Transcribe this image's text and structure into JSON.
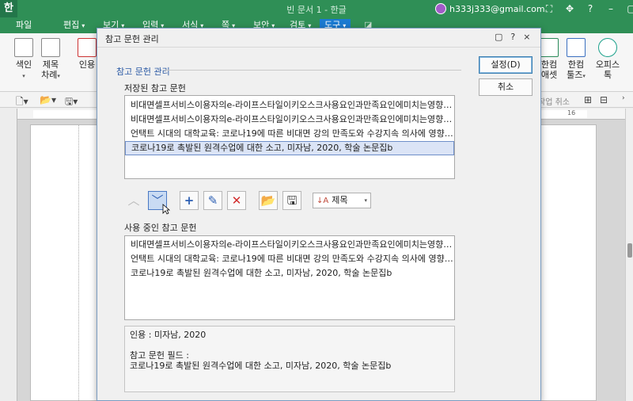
{
  "app": {
    "logo_char": "한",
    "window_title": "빈 문서 1 - 한글",
    "account_email": "h333j333@gmail.com"
  },
  "menu": [
    {
      "label": "파일",
      "caret": ""
    },
    {
      "label": "편집",
      "caret": "▾"
    },
    {
      "label": "보기",
      "caret": "▾"
    },
    {
      "label": "입력",
      "caret": "▾"
    },
    {
      "label": "서식",
      "caret": "▾"
    },
    {
      "label": "쪽",
      "caret": "▾"
    },
    {
      "label": "보안",
      "caret": "▾"
    },
    {
      "label": "검토",
      "caret": "▾"
    },
    {
      "label": "도구",
      "caret": "▾"
    }
  ],
  "ribbon": {
    "left": [
      {
        "label": "색인",
        "caret": "▾"
      },
      {
        "label": "제목",
        "label2": "차례",
        "caret": "▾"
      },
      {
        "label": "인용",
        "caret": ""
      }
    ],
    "right": [
      {
        "label": "한컴",
        "label2": "애셋",
        "caret": ""
      },
      {
        "label": "한컴",
        "label2": "툴즈",
        "caret": "▾"
      },
      {
        "label": "오피스",
        "label2": "톡",
        "caret": ""
      }
    ]
  },
  "toolbar": {
    "undo_label": "작업 취소"
  },
  "ruler": {
    "mark_16": "16"
  },
  "dialog": {
    "title": "참고 문헌 관리",
    "title_buttons": [
      "▢",
      "?",
      "×"
    ],
    "group_label": "참고 문헌 관리",
    "saved_label": "저장된 참고 문헌",
    "saved_items": [
      {
        "text": "비대면셀프서비스이용자의e-라이프스타일이키오스크사용요인과만족요인에미치는영향에관한…",
        "selected": false
      },
      {
        "text": "비대면셀프서비스이용자의e-라이프스타일이키오스크사용요인과만족요인에미치는영향에관한…",
        "selected": false
      },
      {
        "text": "언택트 시대의 대학교육: 코로나19에 따른 비대면 강의 만족도와 수강지속 의사에 영향을 미치…",
        "selected": false
      },
      {
        "text": "코로나19로 촉발된 원격수업에 대한 소고, 미자남, 2020, 학술 논문집b",
        "selected": true
      }
    ],
    "toolbar_icons": [
      {
        "name": "move-up",
        "glyph": "︿",
        "state": "disabled"
      },
      {
        "name": "move-down",
        "glyph": "﹀",
        "state": "pressed"
      },
      {
        "name": "add",
        "glyph": "+",
        "state": "normal"
      },
      {
        "name": "edit",
        "glyph": "✎",
        "state": "normal"
      },
      {
        "name": "delete",
        "glyph": "✕",
        "state": "normal"
      },
      {
        "name": "open-folder",
        "glyph": "📂",
        "state": "normal"
      },
      {
        "name": "save",
        "glyph": "🖫",
        "state": "normal"
      }
    ],
    "sort": {
      "selected": "제목",
      "icon": "↓A",
      "caret": "▾"
    },
    "used_label": "사용 중인 참고 문헌",
    "used_items": [
      "비대면셀프서비스이용자의e-라이프스타일이키오스크사용요인과만족요인에미치는영향에관한…",
      "언택트 시대의 대학교육: 코로나19에 따른 비대면 강의 만족도와 수강지속 의사에 영향을 미치…",
      "코로나19로 촉발된 원격수업에 대한 소고, 미자남, 2020, 학술 논문집b"
    ],
    "info": {
      "citation": "인용 : 미자남, 2020",
      "field_label": "참고 문헌 필드 :",
      "field_value": "코로나19로 촉발된 원격수업에 대한 소고, 미자남, 2020, 학술 논문집b"
    },
    "buttons": {
      "ok": "설정(D)",
      "cancel": "취소"
    }
  },
  "colors": {
    "titlebar": "#2f8f56",
    "active_menu": "#1a7ad1",
    "delete_red": "#d22b2b",
    "edit_blue": "#2c5fb3",
    "selection": "#dbe4f6"
  }
}
